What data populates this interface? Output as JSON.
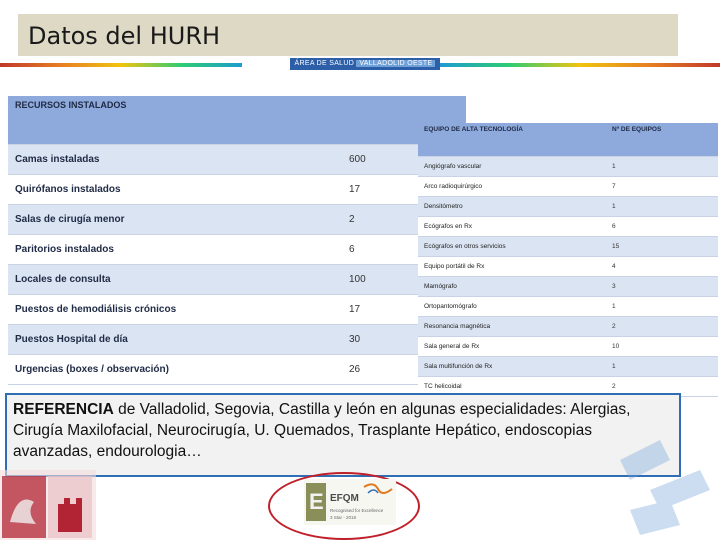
{
  "title": "Datos del HURH",
  "area_logo": {
    "left": "ÁREA DE SALUD",
    "right": "VALLADOLID OESTE"
  },
  "resources": {
    "header": "RECURSOS INSTALADOS",
    "rows": [
      {
        "label": "Camas instaladas",
        "value": "600"
      },
      {
        "label": "Quirófanos instalados",
        "value": "17"
      },
      {
        "label": "Salas de cirugía menor",
        "value": "2"
      },
      {
        "label": "Paritorios instalados",
        "value": "6"
      },
      {
        "label": "Locales de consulta",
        "value": "100"
      },
      {
        "label": "Puestos de hemodiálisis crónicos",
        "value": "17"
      },
      {
        "label": "Puestos Hospital de día",
        "value": "30"
      },
      {
        "label": "Urgencias (boxes / observación)",
        "value": "26"
      }
    ]
  },
  "equipment": {
    "header": {
      "col1": "EQUIPO DE ALTA TECNOLOGÍA",
      "col2": "Nº DE EQUIPOS"
    },
    "rows": [
      {
        "label": "Angiógrafo vascular",
        "value": "1"
      },
      {
        "label": "Arco radioquirúrgico",
        "value": "7"
      },
      {
        "label": "Densitómetro",
        "value": "1"
      },
      {
        "label": "Ecógrafos en Rx",
        "value": "6"
      },
      {
        "label": "Ecógrafos en otros servicios",
        "value": "15"
      },
      {
        "label": "Equipo portátil de Rx",
        "value": "4"
      },
      {
        "label": "Mamógrafo",
        "value": "3"
      },
      {
        "label": "Ortopantomógrafo",
        "value": "1"
      },
      {
        "label": "Resonancia magnética",
        "value": "2"
      },
      {
        "label": "Sala general de Rx",
        "value": "10"
      },
      {
        "label": "Sala multifunción de Rx",
        "value": "1"
      },
      {
        "label": "TC helicoidal",
        "value": "2"
      }
    ]
  },
  "reference": {
    "lead": "REFERENCIA",
    "text": " de Valladolid, Segovia, Castilla y león en algunas especialidades: Alergias, Cirugía Maxilofacial, Neurocirugía, U. Quemados, Trasplante Hepático, endoscopias avanzadas, endourologia…"
  },
  "efqm": {
    "brand": "EFQM",
    "line1": "Recognised for Excellence",
    "line2": "3 Star - 2018"
  },
  "colors": {
    "title_bg": "#ddd9c4",
    "table_header": "#8ea9db",
    "row_alt": "#dbe4f3",
    "ref_border": "#2f6db5",
    "efqm_ring": "#c0202a"
  }
}
